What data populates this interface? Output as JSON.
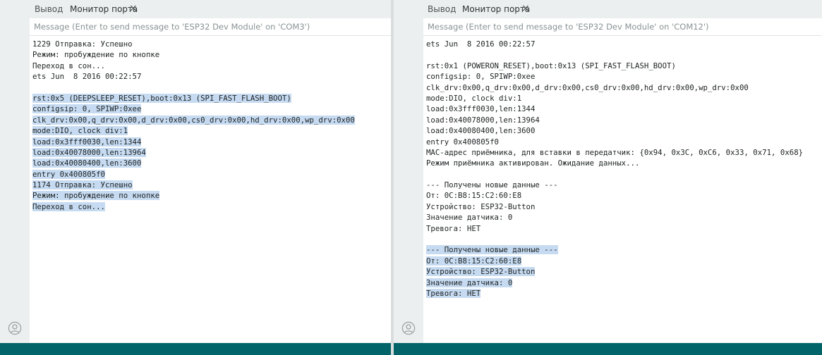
{
  "colors": {
    "statusbar": "#006468",
    "selection": "#c6dbf1",
    "sidebar": "#eceff0"
  },
  "left": {
    "tabs": {
      "output": "Вывод",
      "serial_monitor": "Монитор порта",
      "close_glyph": "×"
    },
    "message": {
      "placeholder": "Message (Enter to send message to 'ESP32 Dev Module' on 'COM3')"
    },
    "log": [
      {
        "text": "1229 Отправка: Успешно",
        "selected": false
      },
      {
        "text": "Режим: пробуждение по кнопке",
        "selected": false
      },
      {
        "text": "Переход в сон...",
        "selected": false
      },
      {
        "text": "ets Jun  8 2016 00:22:57",
        "selected": false
      },
      {
        "text": "",
        "selected": false
      },
      {
        "text": "rst:0x5 (DEEPSLEEP_RESET),boot:0x13 (SPI_FAST_FLASH_BOOT)",
        "selected": true
      },
      {
        "text": "configsip: 0, SPIWP:0xee",
        "selected": true
      },
      {
        "text": "clk_drv:0x00,q_drv:0x00,d_drv:0x00,cs0_drv:0x00,hd_drv:0x00,wp_drv:0x00",
        "selected": true
      },
      {
        "text": "mode:DIO, clock div:1",
        "selected": true
      },
      {
        "text": "load:0x3fff0030,len:1344",
        "selected": true
      },
      {
        "text": "load:0x40078000,len:13964",
        "selected": true
      },
      {
        "text": "load:0x40080400,len:3600",
        "selected": true
      },
      {
        "text": "entry 0x400805f0",
        "selected": true
      },
      {
        "text": "1174 Отправка: Успешно",
        "selected": true
      },
      {
        "text": "Режим: пробуждение по кнопке",
        "selected": true
      },
      {
        "text": "Переход в сон...",
        "selected": true
      }
    ]
  },
  "right": {
    "tabs": {
      "output": "Вывод",
      "serial_monitor": "Монитор порта",
      "close_glyph": "×"
    },
    "message": {
      "placeholder": "Message (Enter to send message to 'ESP32 Dev Module' on 'COM12')"
    },
    "log": [
      {
        "text": "ets Jun  8 2016 00:22:57",
        "selected": false
      },
      {
        "text": "",
        "selected": false
      },
      {
        "text": "rst:0x1 (POWERON_RESET),boot:0x13 (SPI_FAST_FLASH_BOOT)",
        "selected": false
      },
      {
        "text": "configsip: 0, SPIWP:0xee",
        "selected": false
      },
      {
        "text": "clk_drv:0x00,q_drv:0x00,d_drv:0x00,cs0_drv:0x00,hd_drv:0x00,wp_drv:0x00",
        "selected": false
      },
      {
        "text": "mode:DIO, clock div:1",
        "selected": false
      },
      {
        "text": "load:0x3fff0030,len:1344",
        "selected": false
      },
      {
        "text": "load:0x40078000,len:13964",
        "selected": false
      },
      {
        "text": "load:0x40080400,len:3600",
        "selected": false
      },
      {
        "text": "entry 0x400805f0",
        "selected": false
      },
      {
        "text": "MAC-адрес приёмника, для вставки в передатчик: {0x94, 0x3C, 0xC6, 0x33, 0x71, 0x68}",
        "selected": false
      },
      {
        "text": "Режим приёмника активирован. Ожидание данных...",
        "selected": false
      },
      {
        "text": "",
        "selected": false
      },
      {
        "text": "--- Получены новые данные ---",
        "selected": false
      },
      {
        "text": "От: 0C:B8:15:C2:60:E8",
        "selected": false
      },
      {
        "text": "Устройство: ESP32-Button",
        "selected": false
      },
      {
        "text": "Значение датчика: 0",
        "selected": false
      },
      {
        "text": "Тревога: НЕТ",
        "selected": false
      },
      {
        "text": "",
        "selected": false
      },
      {
        "text": "--- Получены новые данные ---",
        "selected": true
      },
      {
        "text": "От: 0C:B8:15:C2:60:E8",
        "selected": true
      },
      {
        "text": "Устройство: ESP32-Button",
        "selected": true
      },
      {
        "text": "Значение датчика: 0",
        "selected": true
      },
      {
        "text": "Тревога: НЕТ",
        "selected": true
      }
    ]
  }
}
